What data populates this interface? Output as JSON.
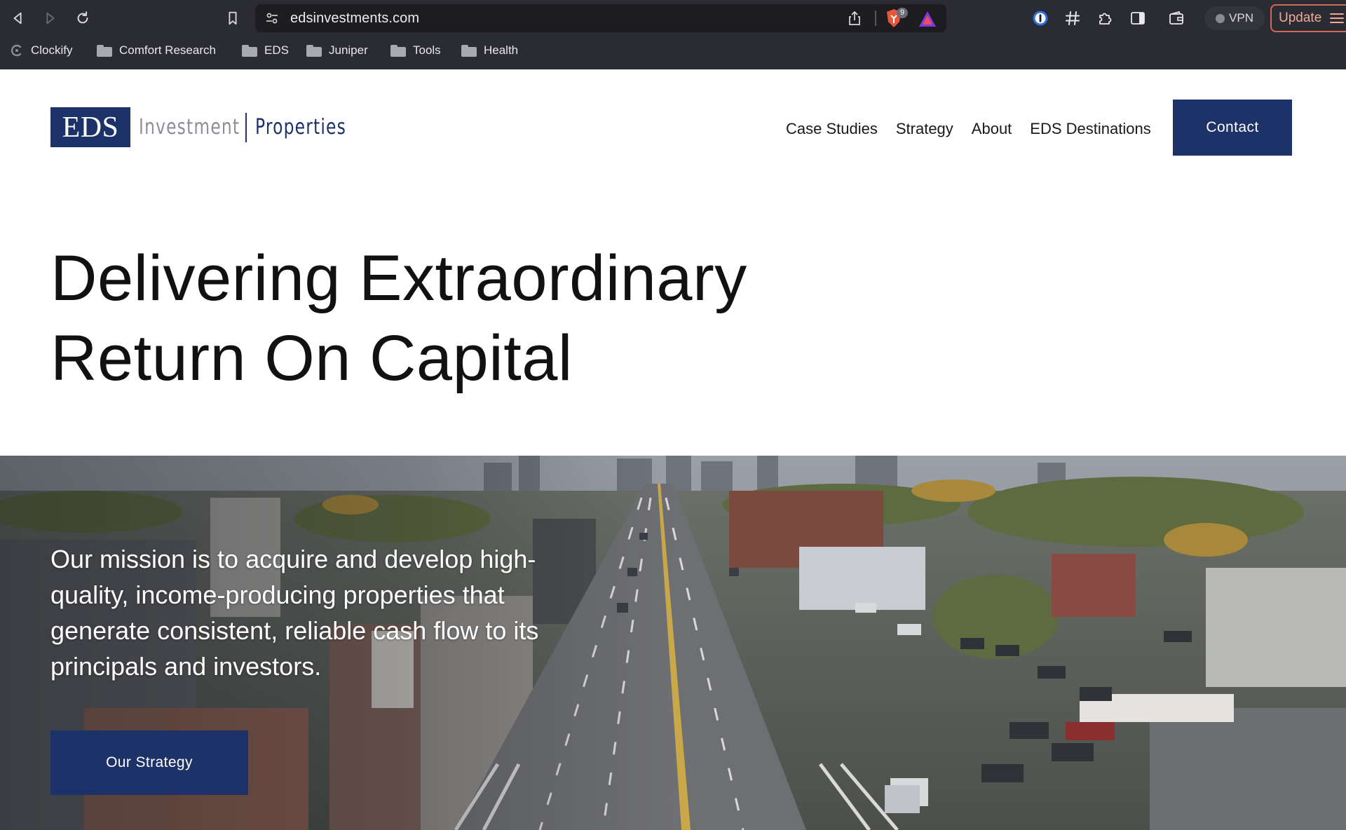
{
  "browser": {
    "url": "edsinvestments.com",
    "shield_count": "9",
    "vpn_label": "VPN",
    "update_label": "Update",
    "bookmarks": [
      {
        "label": "Clockify",
        "icon": "clockify-icon"
      },
      {
        "label": "Comfort Research",
        "icon": "folder-icon"
      },
      {
        "label": "EDS",
        "icon": "folder-icon"
      },
      {
        "label": "Juniper",
        "icon": "folder-icon"
      },
      {
        "label": "Tools",
        "icon": "folder-icon"
      },
      {
        "label": "Health",
        "icon": "folder-icon"
      }
    ]
  },
  "site": {
    "logo": {
      "mark": "EDS",
      "word1": "Investment",
      "word2": "Properties"
    },
    "nav": [
      "Case Studies",
      "Strategy",
      "About",
      "EDS Destinations"
    ],
    "contact_label": "Contact",
    "hero": {
      "line1": "Delivering Extraordinary",
      "line2": "Return On Capital"
    },
    "mission": "Our mission is to acquire and develop high-quality, income-producing properties that generate consistent, reliable cash flow to its principals and investors.",
    "strategy_label": "Our Strategy"
  },
  "colors": {
    "brand_navy": "#1d3268",
    "chrome_bg": "#2b2c33",
    "urlbar_bg": "#1c1c21",
    "update_accent": "#d06a55"
  }
}
